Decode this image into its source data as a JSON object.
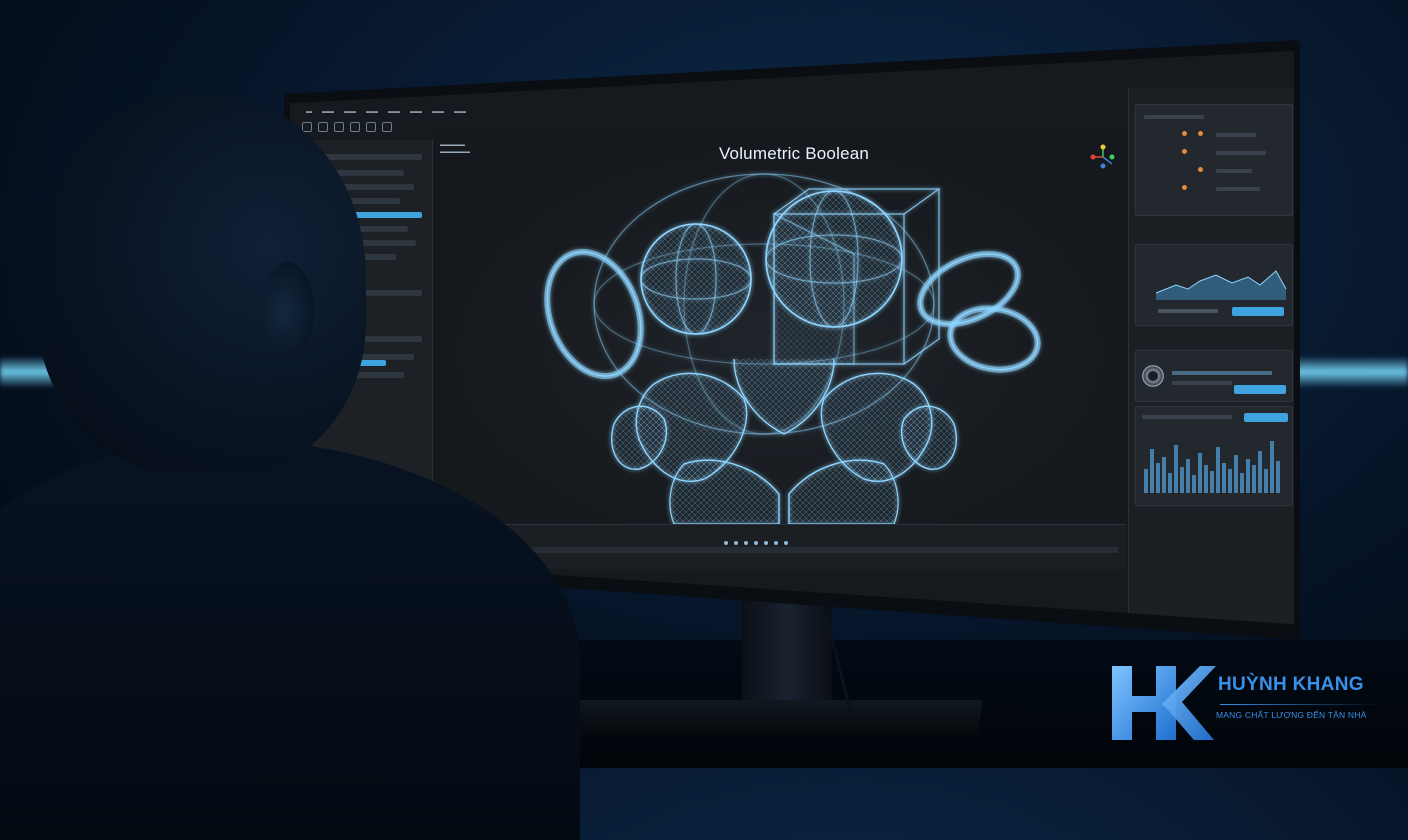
{
  "viewport": {
    "title": "Volumetric Boolean"
  },
  "logo": {
    "name": "HUỲNH KHANG",
    "tagline": "MANG CHẤT LƯỢNG ĐẾN TẬN NHÀ",
    "brand_color": "#3a8fe8"
  },
  "colors": {
    "accent": "#3fa3e0",
    "wireframe": "#8fd6ff",
    "ambient_light": "#78dcff"
  },
  "icons": [
    "axis-gizmo-icon",
    "play-icon"
  ]
}
